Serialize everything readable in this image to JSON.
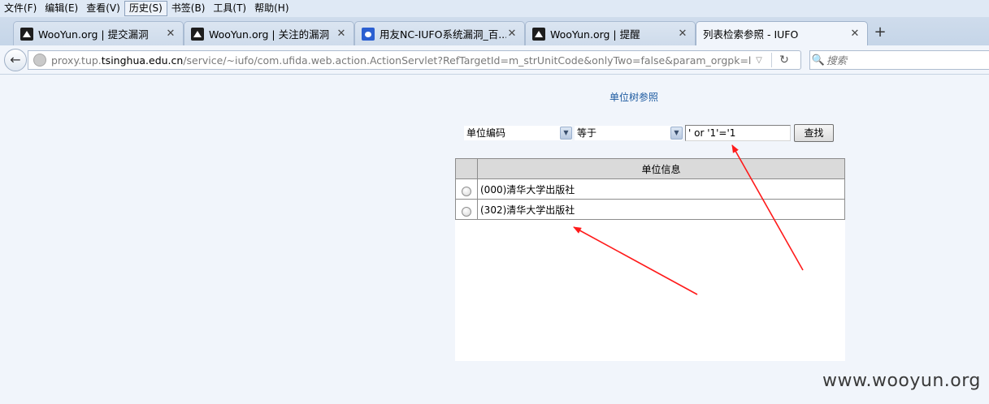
{
  "menubar": {
    "items": [
      "文件(F)",
      "编辑(E)",
      "查看(V)",
      "历史(S)",
      "书签(B)",
      "工具(T)",
      "帮助(H)"
    ]
  },
  "tabs": [
    {
      "label": "WooYun.org | 提交漏洞",
      "icon": "wooyun-favicon"
    },
    {
      "label": "WooYun.org | 关注的漏洞",
      "icon": "wooyun-favicon"
    },
    {
      "label": "用友NC-IUFO系统漏洞_百...",
      "icon": "baidu-favicon"
    },
    {
      "label": "WooYun.org | 提醒",
      "icon": "wooyun-favicon"
    },
    {
      "label": "列表检索参照 - IUFO",
      "icon": ""
    }
  ],
  "navbar": {
    "url_prefix": "proxy.tup.",
    "url_domain": "tsinghua.edu.cn",
    "url_rest": "/service/~iufo/com.ufida.web.action.ActionServlet?RefTargetId=m_strUnitCode&onlyTwo=false&param_orgpk=level_code&",
    "search_placeholder": "搜索"
  },
  "page": {
    "title": "单位树参照",
    "filter_field": "单位编码",
    "filter_op": "等于",
    "filter_value": "' or '1'='1",
    "search_button": "查找",
    "table_header": "单位信息",
    "rows": [
      {
        "label": "(000)清华大学出版社"
      },
      {
        "label": "(302)清华大学出版社"
      }
    ]
  },
  "annotation_color": "#ff1a1a",
  "watermark": "www.wooyun.org"
}
